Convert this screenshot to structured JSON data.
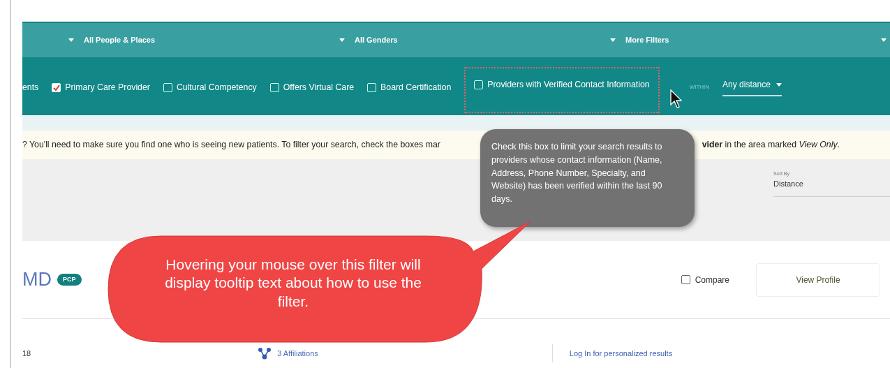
{
  "top_bar": {
    "dropdowns": [
      {
        "label": "All People & Places"
      },
      {
        "label": "All Genders"
      },
      {
        "label": "More Filters"
      }
    ]
  },
  "filters": {
    "items": [
      {
        "kind": "text",
        "label": "ents"
      },
      {
        "kind": "checkbox",
        "label": "Primary Care Provider",
        "checked": true,
        "highlighted": false
      },
      {
        "kind": "checkbox",
        "label": "Cultural Competency",
        "checked": false,
        "highlighted": false
      },
      {
        "kind": "checkbox",
        "label": "Offers Virtual Care",
        "checked": false,
        "highlighted": false
      },
      {
        "kind": "checkbox",
        "label": "Board Certification",
        "checked": false,
        "highlighted": false
      },
      {
        "kind": "checkbox",
        "label": "Providers with Verified Contact Information",
        "checked": false,
        "highlighted": true
      }
    ],
    "within_label": "WITHIN",
    "distance": "Any distance"
  },
  "banner": {
    "left": "? You'll need to make sure you find one who is seeing new patients. To filter your search, check the boxes mar",
    "right": "**vider** in the area marked *View Only*."
  },
  "sort": {
    "label": "Sort By",
    "value": "Distance"
  },
  "result": {
    "name": "MD",
    "badge": "PCP",
    "compare": {
      "label": "Compare",
      "checked": false
    },
    "view_button": "View Profile",
    "stat": "18",
    "affiliations": "3 Affiliations",
    "login_link": "Log In for personalized results"
  },
  "tooltip": {
    "text": "Check this box to limit your search results to providers whose contact information (Name, Address, Phone Number, Specialty, and Website) has been verified within the last 90 days."
  },
  "callout": {
    "text": "Hovering your mouse over this filter will display tooltip text about how to use the filter."
  }
}
